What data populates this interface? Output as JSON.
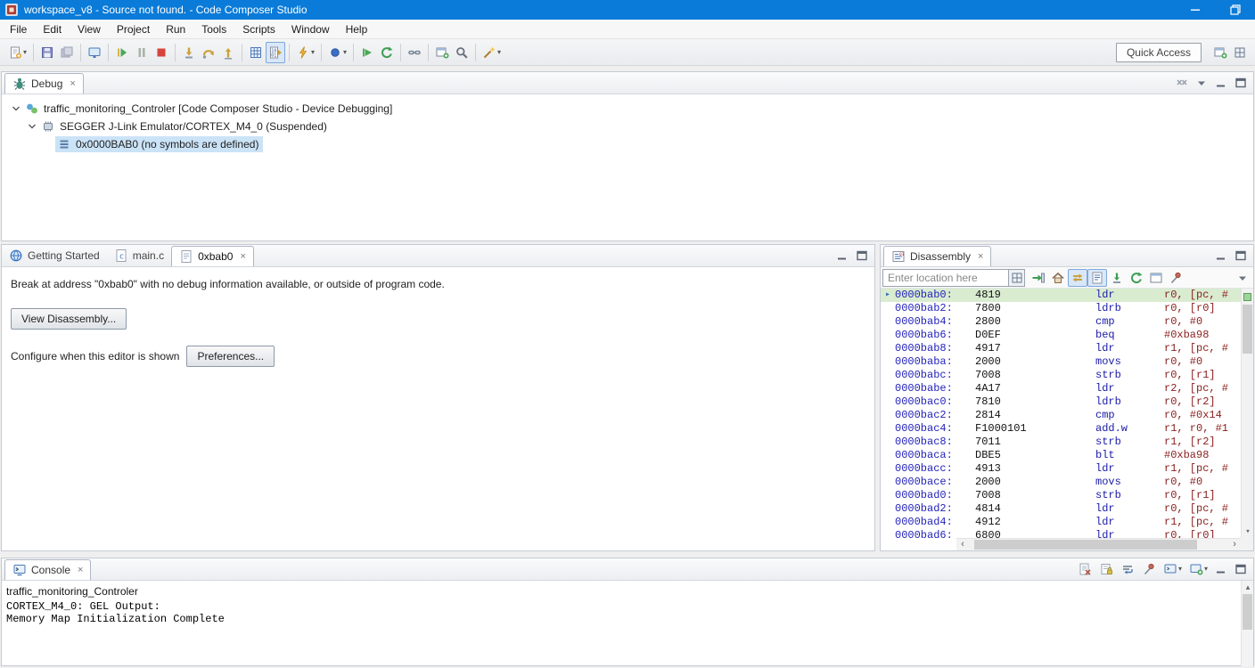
{
  "window": {
    "title": "workspace_v8 - Source not found. - Code Composer Studio"
  },
  "menubar": {
    "items": [
      "File",
      "Edit",
      "View",
      "Project",
      "Run",
      "Tools",
      "Scripts",
      "Window",
      "Help"
    ]
  },
  "toolbar": {
    "quick_access_label": "Quick Access",
    "items": [
      {
        "name": "new-button",
        "icon": "new_file",
        "dropdown": true
      },
      {
        "name": "sep"
      },
      {
        "name": "save-button",
        "icon": "save"
      },
      {
        "name": "save-all-button",
        "icon": "save_all"
      },
      {
        "name": "sep"
      },
      {
        "name": "new-target-configuration-button",
        "icon": "target_config"
      },
      {
        "name": "sep"
      },
      {
        "name": "resume-button",
        "icon": "resume"
      },
      {
        "name": "suspend-button",
        "icon": "suspend"
      },
      {
        "name": "terminate-button",
        "icon": "terminate"
      },
      {
        "name": "sep"
      },
      {
        "name": "step-into-button",
        "icon": "step_into"
      },
      {
        "name": "step-over-button",
        "icon": "step_over"
      },
      {
        "name": "step-return-button",
        "icon": "step_return"
      },
      {
        "name": "sep"
      },
      {
        "name": "view-registers-button",
        "icon": "registers"
      },
      {
        "name": "assembly-step-mode-toggle",
        "icon": "asm_step",
        "active": true
      },
      {
        "name": "sep"
      },
      {
        "name": "flash-button",
        "icon": "flash",
        "dropdown": true
      },
      {
        "name": "sep"
      },
      {
        "name": "breakpoint-button",
        "icon": "breakpoint",
        "dropdown": true
      },
      {
        "name": "sep"
      },
      {
        "name": "restart-button",
        "icon": "restart"
      },
      {
        "name": "refresh-button",
        "icon": "refresh"
      },
      {
        "name": "sep"
      },
      {
        "name": "connect-target-button",
        "icon": "connect"
      },
      {
        "name": "sep"
      },
      {
        "name": "new-window-button",
        "icon": "window_plus"
      },
      {
        "name": "search-button",
        "icon": "search"
      },
      {
        "name": "sep"
      },
      {
        "name": "open-element-button",
        "icon": "wand",
        "dropdown": true
      }
    ]
  },
  "debug_panel": {
    "tab_label": "Debug",
    "tree": [
      {
        "label": "traffic_monitoring_Controler [Code Composer Studio - Device Debugging]",
        "level": 0,
        "expander": true,
        "icon": "debug_session",
        "icon_name": "debug-session-icon",
        "selected": false
      },
      {
        "label": "SEGGER J-Link Emulator/CORTEX_M4_0 (Suspended)",
        "level": 1,
        "expander": true,
        "icon": "core",
        "icon_name": "core-icon",
        "selected": false
      },
      {
        "label": "0x0000BAB0  (no symbols are defined)",
        "level": 2,
        "expander": false,
        "icon": "stack_frame",
        "icon_name": "stack-frame-icon",
        "selected": true
      }
    ]
  },
  "editor": {
    "tabs": [
      {
        "label": "Getting Started",
        "icon": "globe",
        "active": false,
        "closable": false
      },
      {
        "label": "main.c",
        "icon": "c_file",
        "active": false,
        "closable": false
      },
      {
        "label": "0xbab0",
        "icon": "page",
        "active": true,
        "closable": true
      }
    ],
    "message": "Break at address \"0xbab0\" with no debug information available, or outside of program code.",
    "configure_label": "Configure when this editor is shown",
    "buttons": {
      "view_disassembly": "View Disassembly...",
      "preferences": "Preferences..."
    }
  },
  "disassembly": {
    "tab_label": "Disassembly",
    "location_placeholder": "Enter location here",
    "toolbar_items": [
      {
        "name": "locate-pc-button",
        "icon": "locate_pc"
      },
      {
        "name": "home-button",
        "icon": "home"
      },
      {
        "name": "sync-with-execution-toggle",
        "icon": "sync",
        "active": true
      },
      {
        "name": "show-source-toggle",
        "icon": "source_page",
        "active": true
      },
      {
        "name": "assembly-step-into-button",
        "icon": "step_green"
      },
      {
        "name": "refresh-view-button",
        "icon": "refresh"
      },
      {
        "name": "open-new-view-button",
        "icon": "new_view"
      },
      {
        "name": "pin-view-button",
        "icon": "pin"
      }
    ],
    "rows": [
      {
        "addr": "0000bab0:",
        "opcode": "4819",
        "mnemonic": "ldr",
        "operands": "r0, [pc, #",
        "current": true
      },
      {
        "addr": "0000bab2:",
        "opcode": "7800",
        "mnemonic": "ldrb",
        "operands": "r0, [r0]"
      },
      {
        "addr": "0000bab4:",
        "opcode": "2800",
        "mnemonic": "cmp",
        "operands": "r0, #0"
      },
      {
        "addr": "0000bab6:",
        "opcode": "D0EF",
        "mnemonic": "beq",
        "operands": "#0xba98"
      },
      {
        "addr": "0000bab8:",
        "opcode": "4917",
        "mnemonic": "ldr",
        "operands": "r1, [pc, #"
      },
      {
        "addr": "0000baba:",
        "opcode": "2000",
        "mnemonic": "movs",
        "operands": "r0, #0"
      },
      {
        "addr": "0000babc:",
        "opcode": "7008",
        "mnemonic": "strb",
        "operands": "r0, [r1]"
      },
      {
        "addr": "0000babe:",
        "opcode": "4A17",
        "mnemonic": "ldr",
        "operands": "r2, [pc, #"
      },
      {
        "addr": "0000bac0:",
        "opcode": "7810",
        "mnemonic": "ldrb",
        "operands": "r0, [r2]"
      },
      {
        "addr": "0000bac2:",
        "opcode": "2814",
        "mnemonic": "cmp",
        "operands": "r0, #0x14"
      },
      {
        "addr": "0000bac4:",
        "opcode": "F1000101",
        "mnemonic": "add.w",
        "operands": "r1, r0, #1"
      },
      {
        "addr": "0000bac8:",
        "opcode": "7011",
        "mnemonic": "strb",
        "operands": "r1, [r2]"
      },
      {
        "addr": "0000baca:",
        "opcode": "DBE5",
        "mnemonic": "blt",
        "operands": "#0xba98"
      },
      {
        "addr": "0000bacc:",
        "opcode": "4913",
        "mnemonic": "ldr",
        "operands": "r1, [pc, #"
      },
      {
        "addr": "0000bace:",
        "opcode": "2000",
        "mnemonic": "movs",
        "operands": "r0, #0"
      },
      {
        "addr": "0000bad0:",
        "opcode": "7008",
        "mnemonic": "strb",
        "operands": "r0, [r1]"
      },
      {
        "addr": "0000bad2:",
        "opcode": "4814",
        "mnemonic": "ldr",
        "operands": "r0, [pc, #"
      },
      {
        "addr": "0000bad4:",
        "opcode": "4912",
        "mnemonic": "ldr",
        "operands": "r1, [pc, #"
      },
      {
        "addr": "0000bad6:",
        "opcode": "6800",
        "mnemonic": "ldr",
        "operands": "r0, [r0]"
      }
    ]
  },
  "console": {
    "tab_label": "Console",
    "process_label": "traffic_monitoring_Controler",
    "lines": [
      "CORTEX_M4_0: GEL Output:",
      "Memory Map Initialization Complete"
    ],
    "toolbar_items": [
      {
        "name": "clear-console-button",
        "icon": "clear"
      },
      {
        "name": "scroll-lock-toggle",
        "icon": "scroll_lock"
      },
      {
        "name": "word-wrap-toggle",
        "icon": "word_wrap"
      },
      {
        "name": "pin-console-toggle",
        "icon": "pin"
      },
      {
        "name": "display-selected-console-button",
        "icon": "console_display",
        "dropdown": true
      },
      {
        "name": "open-console-button",
        "icon": "open_console",
        "dropdown": true
      }
    ]
  },
  "colors": {
    "titlebar": "#0a7bd8",
    "selection_background": "#cbe3f7",
    "current_line_background": "#d9ecd0",
    "address_color": "#2222bb",
    "opcode_color": "#111111",
    "mnemonic_color": "#1a1aa6",
    "operand_color": "#8b1d1d",
    "active_toggle_background": "#d9e7f8"
  }
}
